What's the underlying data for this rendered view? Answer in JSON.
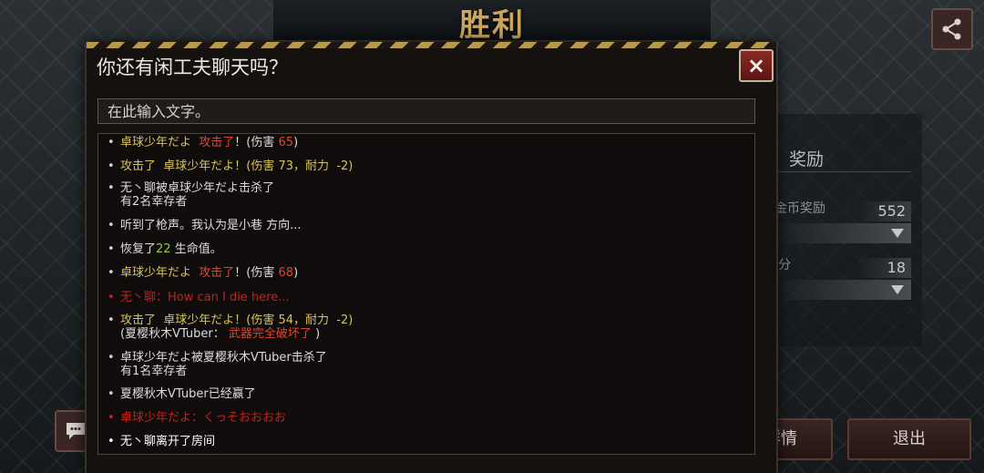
{
  "background": {
    "title": "胜利",
    "reward_label": "奖励",
    "stat1_label": "金币奖励",
    "stat1_value": "552",
    "stat2_label": "积分",
    "stat2_value": "18",
    "details_label": "详情",
    "exit_label": "退出"
  },
  "dialog": {
    "title": "你还有闲工夫聊天吗？",
    "close_label": "×",
    "input_placeholder": "在此输入文字。"
  },
  "chat": {
    "m1": {
      "a": "卓球少年だよ",
      "b": "攻击了",
      "c": "！(伤害",
      "d": "65",
      "e": ")"
    },
    "m2": {
      "a": "攻击了",
      "b": "卓球少年だよ！(伤害",
      "c": "73",
      "d": "，耐力",
      "e": "-2",
      "f": ")"
    },
    "m3": {
      "a": "无丶聊",
      "b": "被",
      "c": "卓球少年だよ",
      "d": "击杀了",
      "e": "有2名幸存者"
    },
    "m4": {
      "a": "听到了枪声。我认为是小巷 方向..."
    },
    "m5": {
      "a": "恢复了",
      "b": "22",
      "c": "生命值。"
    },
    "m6": {
      "a": "卓球少年だよ",
      "b": "攻击了",
      "c": "！(伤害",
      "d": "68",
      "e": ")"
    },
    "m7": {
      "a": "无丶聊：How can I die here..."
    },
    "m8": {
      "a": "攻击了",
      "b": "卓球少年だよ！(伤害",
      "c": "54",
      "d": "，耐力",
      "e": "-2",
      "f": ")",
      "g": "(夏樱秋木VTuber：",
      "h": "武器完全破坏了",
      "i": ")"
    },
    "m9": {
      "a": "卓球少年だよ",
      "b": "被",
      "c": "夏樱秋木VTuber",
      "d": "击杀了",
      "e": "有1名幸存者"
    },
    "m10": {
      "a": "夏樱秋木VTuber已经赢了"
    },
    "m11": {
      "a": "卓球少年だよ：くっそおおおお"
    },
    "m12": {
      "a": "无丶聊离开了房间"
    }
  }
}
